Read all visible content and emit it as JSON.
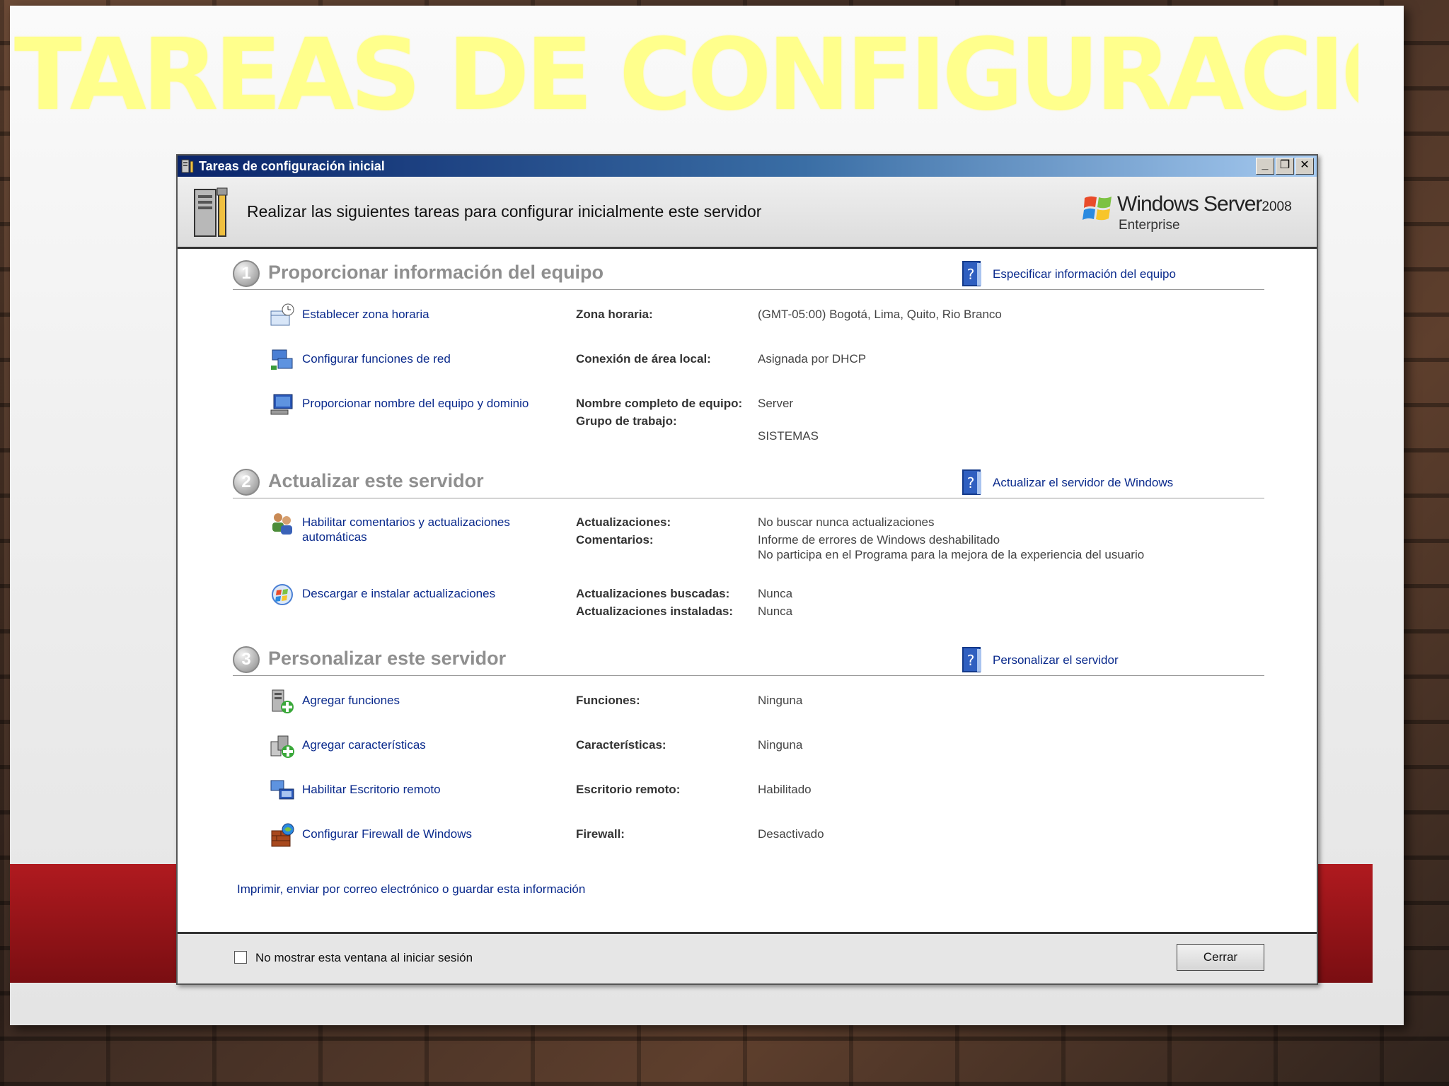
{
  "slide": {
    "title": "TAREAS DE CONFIGURACIÓN INICIAL"
  },
  "window": {
    "title": "Tareas de configuración inicial",
    "controls": {
      "minimize": "_",
      "restore": "❐",
      "close": "✕"
    }
  },
  "header": {
    "instruction": "Realizar las siguientes tareas para configurar inicialmente este servidor",
    "brand_name": "Windows Server",
    "brand_year": "2008",
    "brand_edition": "Enterprise"
  },
  "sections": [
    {
      "number": "1",
      "title": "Proporcionar información del equipo",
      "help": "Especificar información del equipo",
      "tasks": [
        {
          "link": "Establecer zona horaria",
          "labels": [
            "Zona horaria:"
          ],
          "values": [
            "(GMT-05:00) Bogotá, Lima, Quito, Rio Branco"
          ]
        },
        {
          "link": "Configurar funciones de red",
          "labels": [
            "Conexión de área local:"
          ],
          "values": [
            "Asignada por DHCP"
          ]
        },
        {
          "link": "Proporcionar nombre del equipo y dominio",
          "labels": [
            "Nombre completo de equipo:",
            "Grupo de trabajo:"
          ],
          "values": [
            "Server",
            "SISTEMAS"
          ]
        }
      ]
    },
    {
      "number": "2",
      "title": "Actualizar este servidor",
      "help": "Actualizar el servidor de Windows",
      "tasks": [
        {
          "link": "Habilitar comentarios y actualizaciones automáticas",
          "labels": [
            "Actualizaciones:",
            "Comentarios:"
          ],
          "values": [
            "No buscar nunca actualizaciones",
            "Informe de errores de Windows deshabilitado",
            "No participa en el Programa para la mejora de la experiencia del usuario"
          ]
        },
        {
          "link": "Descargar e instalar actualizaciones",
          "labels": [
            "Actualizaciones buscadas:",
            "Actualizaciones instaladas:"
          ],
          "values": [
            "Nunca",
            "Nunca"
          ]
        }
      ]
    },
    {
      "number": "3",
      "title": "Personalizar este servidor",
      "help": "Personalizar el servidor",
      "tasks": [
        {
          "link": "Agregar funciones",
          "labels": [
            "Funciones:"
          ],
          "values": [
            "Ninguna"
          ]
        },
        {
          "link": "Agregar características",
          "labels": [
            "Características:"
          ],
          "values": [
            "Ninguna"
          ]
        },
        {
          "link": "Habilitar Escritorio remoto",
          "labels": [
            "Escritorio remoto:"
          ],
          "values": [
            "Habilitado"
          ]
        },
        {
          "link": "Configurar Firewall de Windows",
          "labels": [
            "Firewall:"
          ],
          "values": [
            "Desactivado"
          ]
        }
      ]
    }
  ],
  "print_link": "Imprimir, enviar por correo electrónico o guardar esta información",
  "footer": {
    "checkbox_label": "No mostrar esta ventana al iniciar sesión",
    "close_label": "Cerrar"
  },
  "colors": {
    "link": "#0a2a8c",
    "title_yellow": "#ffff8c",
    "band_red": "#9a1418"
  }
}
